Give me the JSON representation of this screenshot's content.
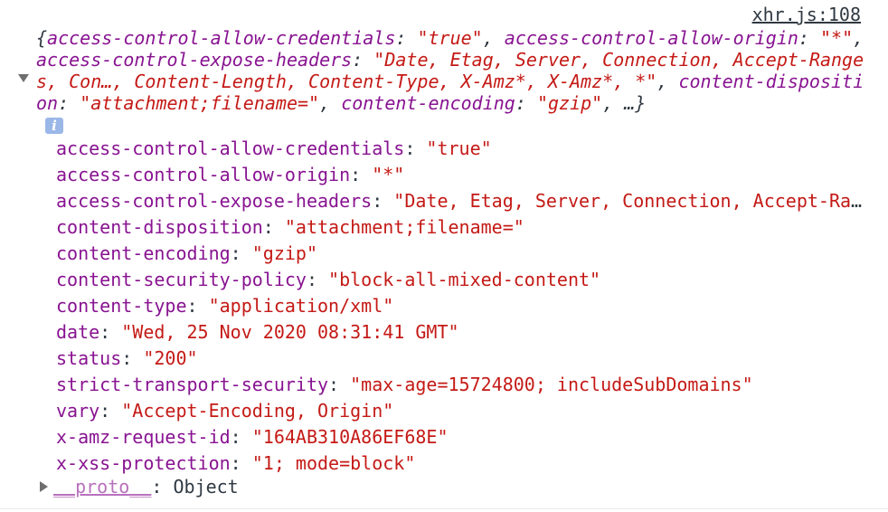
{
  "source_link": "xhr.js:108",
  "summary": {
    "open": "{",
    "entries": [
      {
        "key": "access-control-allow-credentials",
        "value": "\"true\""
      },
      {
        "key": "access-control-allow-origin",
        "value": "\"*\""
      },
      {
        "key": "access-control-expose-headers",
        "value": "\"Date, Etag, Server, Connection, Accept-Ranges, Con…, Content-Length, Content-Type, X-Amz*, X-Amz*, *\""
      },
      {
        "key": "content-disposition",
        "value": "\"attachment;filename=\""
      },
      {
        "key": "content-encoding",
        "value": "\"gzip\""
      }
    ],
    "close": ", …}"
  },
  "info_icon_glyph": "i",
  "properties": [
    {
      "key": "access-control-allow-credentials",
      "value": "\"true\""
    },
    {
      "key": "access-control-allow-origin",
      "value": "\"*\""
    },
    {
      "key": "access-control-expose-headers",
      "value": "\"Date, Etag, Server, Connection, Accept-Ranges, Content-Length\""
    },
    {
      "key": "content-disposition",
      "value": "\"attachment;filename=\""
    },
    {
      "key": "content-encoding",
      "value": "\"gzip\""
    },
    {
      "key": "content-security-policy",
      "value": "\"block-all-mixed-content\""
    },
    {
      "key": "content-type",
      "value": "\"application/xml\""
    },
    {
      "key": "date",
      "value": "\"Wed, 25 Nov 2020 08:31:41 GMT\""
    },
    {
      "key": "status",
      "value": "\"200\""
    },
    {
      "key": "strict-transport-security",
      "value": "\"max-age=15724800; includeSubDomains\""
    },
    {
      "key": "vary",
      "value": "\"Accept-Encoding, Origin\""
    },
    {
      "key": "x-amz-request-id",
      "value": "\"164AB310A86EF68E\""
    },
    {
      "key": "x-xss-protection",
      "value": "\"1; mode=block\""
    }
  ],
  "proto": {
    "key": "__proto__",
    "value": "Object"
  },
  "colors": {
    "key": "#881391",
    "string": "#c41a16",
    "text": "#303942",
    "proto": "#b871bd"
  }
}
